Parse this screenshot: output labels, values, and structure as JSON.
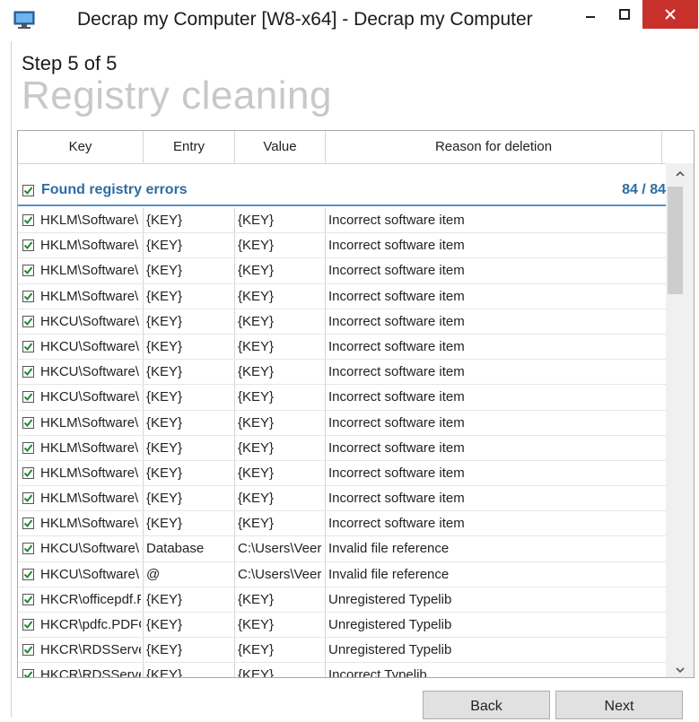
{
  "window": {
    "title": "Decrap my Computer [W8-x64] - Decrap my Computer",
    "icon": "monitor-app-icon",
    "controls": {
      "minimize": "minimize-icon",
      "maximize": "maximize-icon",
      "close": "close-icon"
    }
  },
  "wizard": {
    "step_label": "Step 5 of 5",
    "page_title": "Registry cleaning"
  },
  "list": {
    "columns": [
      "Key",
      "Entry",
      "Value",
      "Reason for deletion"
    ],
    "group": {
      "label": "Found registry errors",
      "count": "84 / 84",
      "checked": true
    },
    "rows": [
      {
        "key": "HKLM\\Software\\",
        "entry": "{KEY}",
        "value": "{KEY}",
        "reason": "Incorrect software item",
        "checked": true
      },
      {
        "key": "HKLM\\Software\\",
        "entry": "{KEY}",
        "value": "{KEY}",
        "reason": "Incorrect software item",
        "checked": true
      },
      {
        "key": "HKLM\\Software\\",
        "entry": "{KEY}",
        "value": "{KEY}",
        "reason": "Incorrect software item",
        "checked": true
      },
      {
        "key": "HKLM\\Software\\",
        "entry": "{KEY}",
        "value": "{KEY}",
        "reason": "Incorrect software item",
        "checked": true
      },
      {
        "key": "HKCU\\Software\\",
        "entry": "{KEY}",
        "value": "{KEY}",
        "reason": "Incorrect software item",
        "checked": true
      },
      {
        "key": "HKCU\\Software\\",
        "entry": "{KEY}",
        "value": "{KEY}",
        "reason": "Incorrect software item",
        "checked": true
      },
      {
        "key": "HKCU\\Software\\",
        "entry": "{KEY}",
        "value": "{KEY}",
        "reason": "Incorrect software item",
        "checked": true
      },
      {
        "key": "HKCU\\Software\\",
        "entry": "{KEY}",
        "value": "{KEY}",
        "reason": "Incorrect software item",
        "checked": true
      },
      {
        "key": "HKLM\\Software\\",
        "entry": "{KEY}",
        "value": "{KEY}",
        "reason": "Incorrect software item",
        "checked": true
      },
      {
        "key": "HKLM\\Software\\",
        "entry": "{KEY}",
        "value": "{KEY}",
        "reason": "Incorrect software item",
        "checked": true
      },
      {
        "key": "HKLM\\Software\\",
        "entry": "{KEY}",
        "value": "{KEY}",
        "reason": "Incorrect software item",
        "checked": true
      },
      {
        "key": "HKLM\\Software\\",
        "entry": "{KEY}",
        "value": "{KEY}",
        "reason": "Incorrect software item",
        "checked": true
      },
      {
        "key": "HKLM\\Software\\",
        "entry": "{KEY}",
        "value": "{KEY}",
        "reason": "Incorrect software item",
        "checked": true
      },
      {
        "key": "HKCU\\Software\\",
        "entry": "Database",
        "value": "C:\\Users\\Veer",
        "reason": "Invalid file reference",
        "checked": true
      },
      {
        "key": "HKCU\\Software\\",
        "entry": "@",
        "value": "C:\\Users\\Veer",
        "reason": "Invalid file reference",
        "checked": true
      },
      {
        "key": "HKCR\\officepdf.P",
        "entry": "{KEY}",
        "value": "{KEY}",
        "reason": "Unregistered Typelib",
        "checked": true
      },
      {
        "key": "HKCR\\pdfc.PDFC",
        "entry": "{KEY}",
        "value": "{KEY}",
        "reason": "Unregistered Typelib",
        "checked": true
      },
      {
        "key": "HKCR\\RDSServer",
        "entry": "{KEY}",
        "value": "{KEY}",
        "reason": "Unregistered Typelib",
        "checked": true
      },
      {
        "key": "HKCR\\RDSServer",
        "entry": "{KEY}",
        "value": "{KEY}",
        "reason": "Incorrect Typelib",
        "checked": true
      }
    ]
  },
  "buttons": {
    "back": "Back",
    "next": "Next"
  },
  "colors": {
    "close": "#c7302b",
    "group_text": "#2d6ca5",
    "check": "#1f8a2f",
    "title_gray": "#c8c8c8"
  }
}
